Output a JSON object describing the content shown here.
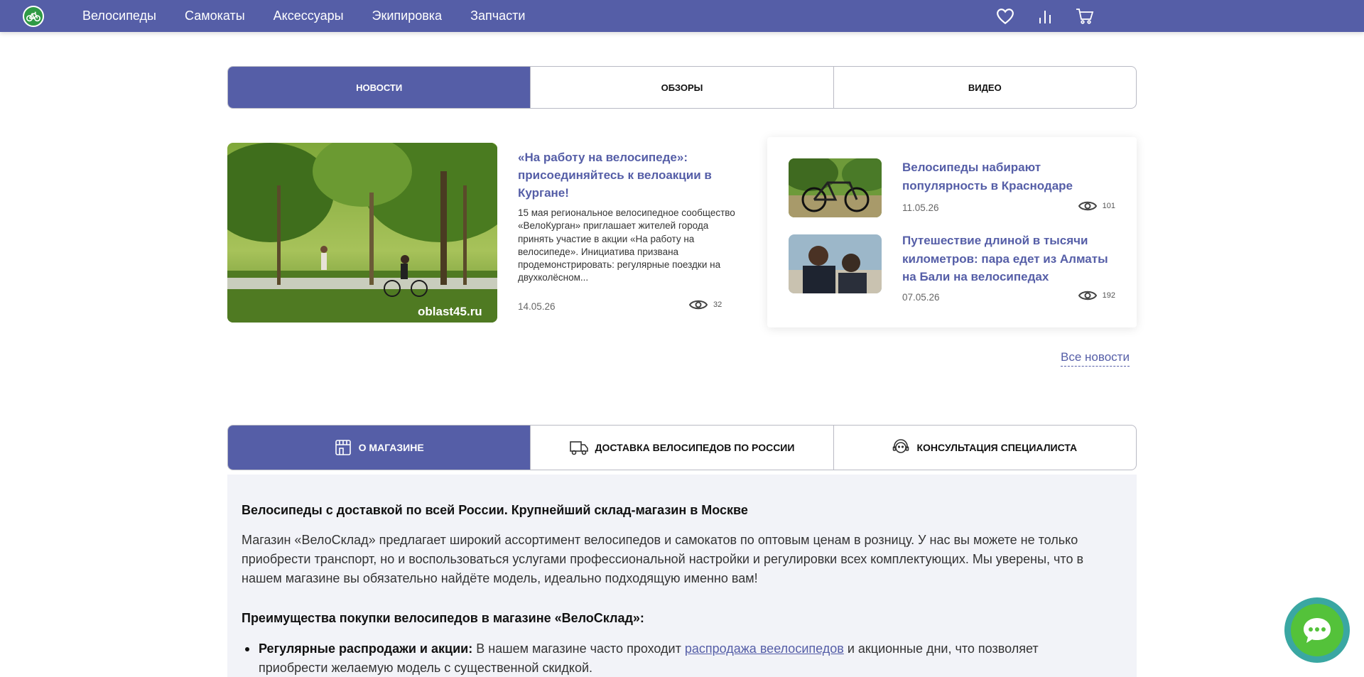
{
  "nav": {
    "items": [
      "Велосипеды",
      "Самокаты",
      "Аксессуары",
      "Экипировка",
      "Запчасти"
    ],
    "icons": [
      "heart-icon",
      "compare-icon",
      "cart-icon"
    ]
  },
  "news_tabs": [
    "Новости",
    "Обзоры",
    "Видео"
  ],
  "main_news": {
    "title": "«На работу на велосипеде»: присоединяйтесь к велоакции в Кургане!",
    "text": "15 мая региональное велосипедное сообщество «ВелоКурган» приглашает жителей города принять участие в акции «На работу на велосипеде». Инициатива призвана продемонстрировать: регулярные поездки на двухколёсном...",
    "date": "14.05.26",
    "views": "32",
    "watermark": "oblast45.ru"
  },
  "side_news": [
    {
      "title": "Велосипеды набирают популярность в Краснодаре",
      "date": "11.05.26",
      "views": "101"
    },
    {
      "title": "Путешествие длиной в тысячи километров: пара едет из Алматы на Бали на велосипедах",
      "date": "07.05.26",
      "views": "192"
    }
  ],
  "all_news_label": "Все новости",
  "info_tabs": [
    "О магазине",
    "Доставка велосипедов по России",
    "Консультация специалиста"
  ],
  "about": {
    "heading": "Велосипеды с доставкой по всей России. Крупнейший склад-магазин в Москве",
    "paragraph": "Магазин «ВелоСклад» предлагает широкий ассортимент велосипедов и самокатов по оптовым ценам в розницу. У нас вы можете не только приобрести транспорт, но и воспользоваться услугами профессиональной настройки и регулировки всех комплектующих. Мы уверены, что в нашем магазине вы обязательно найдёте модель, идеально подходящую именно вам!",
    "benefits_heading": "Преимущества покупки велосипедов в магазине «ВелоСклад»:",
    "benefit_1_bold": "Регулярные распродажи и акции:",
    "benefit_1_before": " В нашем магазине часто проходит ",
    "benefit_1_link": "распродажа веелосипедов",
    "benefit_1_after": " и акционные дни, что позволяет приобрести желаемую модель с существенной скидкой."
  },
  "colors": {
    "brand": "#555ea7",
    "chat_outer": "#3aa7a2",
    "chat_inner": "#54c23a"
  }
}
